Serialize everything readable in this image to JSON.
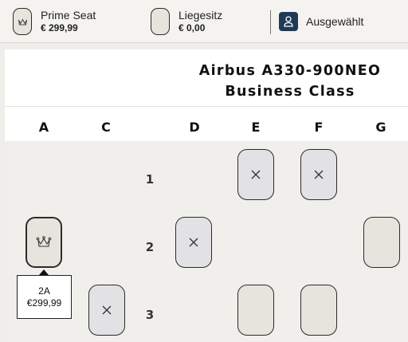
{
  "legend": {
    "prime": {
      "name": "Prime Seat",
      "price": "€ 299,99",
      "icon": "crown-icon"
    },
    "recliner": {
      "name": "Liegesitz",
      "price": "€ 0,00"
    },
    "selected": {
      "label": "Ausgewählt",
      "icon": "person-icon",
      "color": "#1e3a57"
    }
  },
  "cabin": {
    "aircraft": "Airbus A330-900NEO",
    "class_name": "Business Class"
  },
  "columns": [
    "A",
    "C",
    "D",
    "E",
    "F",
    "G"
  ],
  "rows": [
    "1",
    "2",
    "3"
  ],
  "seats": [
    {
      "id": "1E",
      "status": "occupied"
    },
    {
      "id": "1F",
      "status": "occupied"
    },
    {
      "id": "2A",
      "status": "prime"
    },
    {
      "id": "2D",
      "status": "occupied"
    },
    {
      "id": "2G",
      "status": "available"
    },
    {
      "id": "3C",
      "status": "occupied"
    },
    {
      "id": "3E",
      "status": "available"
    },
    {
      "id": "3F",
      "status": "available"
    }
  ],
  "tooltip": {
    "seat": "2A",
    "price": "€299,99"
  },
  "colors": {
    "occupied": "#e2e1e3",
    "available": "#e6e4dc",
    "border": "#2b2b2b"
  }
}
